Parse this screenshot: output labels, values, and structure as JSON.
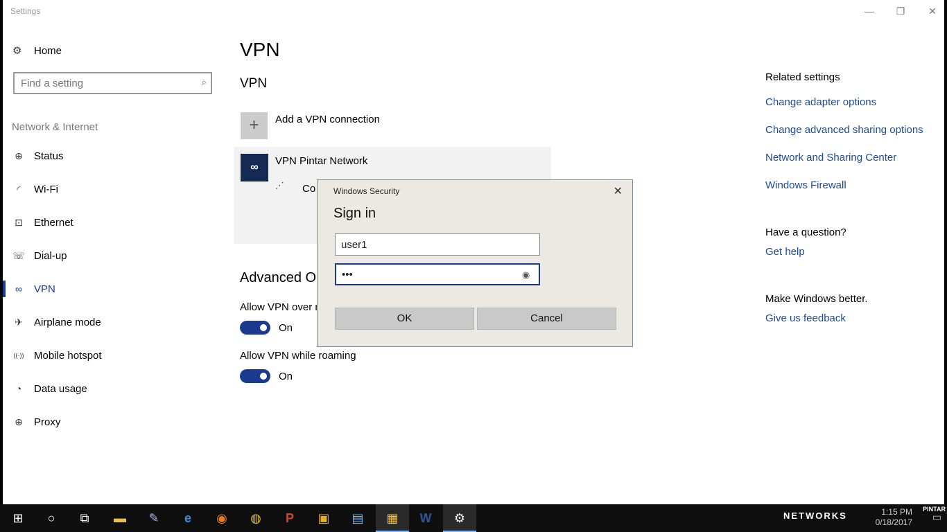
{
  "window": {
    "title": "Settings",
    "controls": {
      "minimize": "—",
      "restore": "❐",
      "close": "✕"
    }
  },
  "sidebar": {
    "home_label": "Home",
    "home_icon": "gear-icon",
    "search_placeholder": "Find a setting",
    "section_title": "Network & Internet",
    "items": [
      {
        "label": "Status",
        "icon": "globe-icon",
        "glyph": "⊕"
      },
      {
        "label": "Wi-Fi",
        "icon": "wifi-icon",
        "glyph": "◜"
      },
      {
        "label": "Ethernet",
        "icon": "ethernet-icon",
        "glyph": "⊡"
      },
      {
        "label": "Dial-up",
        "icon": "phone-icon",
        "glyph": "☏"
      },
      {
        "label": "VPN",
        "icon": "vpn-icon",
        "glyph": "∞",
        "active": true
      },
      {
        "label": "Airplane mode",
        "icon": "airplane-icon",
        "glyph": "✈"
      },
      {
        "label": "Mobile hotspot",
        "icon": "hotspot-icon",
        "glyph": "((·))"
      },
      {
        "label": "Data usage",
        "icon": "data-usage-icon",
        "glyph": "◔"
      },
      {
        "label": "Proxy",
        "icon": "proxy-globe-icon",
        "glyph": "⊕"
      }
    ]
  },
  "main": {
    "page_title": "VPN",
    "section_title": "VPN",
    "add_vpn_label": "Add a VPN connection",
    "vpn_connection": {
      "name": "VPN Pintar Network",
      "status": "Co"
    },
    "advanced_title": "Advanced Op",
    "options": [
      {
        "label": "Allow VPN over m",
        "toggle": "On"
      },
      {
        "label": "Allow VPN while roaming",
        "toggle": "On"
      }
    ]
  },
  "related": {
    "title": "Related settings",
    "links": [
      "Change adapter options",
      "Change advanced sharing options",
      "Network and Sharing Center",
      "Windows Firewall"
    ],
    "question_title": "Have a question?",
    "help_link": "Get help",
    "feedback_title": "Make Windows better.",
    "feedback_link": "Give us feedback"
  },
  "dialog": {
    "window_title": "Windows Security",
    "heading": "Sign in",
    "username": "user1",
    "password": "•••",
    "ok_label": "OK",
    "cancel_label": "Cancel"
  },
  "taskbar": {
    "apps": [
      {
        "name": "start-button",
        "glyph": "⊞"
      },
      {
        "name": "cortana-search",
        "glyph": "○"
      },
      {
        "name": "task-view",
        "glyph": "⧉"
      },
      {
        "name": "file-explorer",
        "glyph": "▬"
      },
      {
        "name": "paint",
        "glyph": "✎"
      },
      {
        "name": "edge",
        "glyph": "e"
      },
      {
        "name": "firefox",
        "glyph": "◉"
      },
      {
        "name": "chrome",
        "glyph": "◍"
      },
      {
        "name": "powerpoint",
        "glyph": "P"
      },
      {
        "name": "app-yellow",
        "glyph": "▣"
      },
      {
        "name": "photos",
        "glyph": "▤"
      },
      {
        "name": "app-active",
        "glyph": "▦",
        "active": true
      },
      {
        "name": "word",
        "glyph": "W"
      },
      {
        "name": "settings",
        "glyph": "⚙",
        "active": true
      }
    ],
    "brand": "NETWORKS",
    "time": "1:15 PM",
    "date": "0/18/2017",
    "corner_label": "PINTAR"
  }
}
